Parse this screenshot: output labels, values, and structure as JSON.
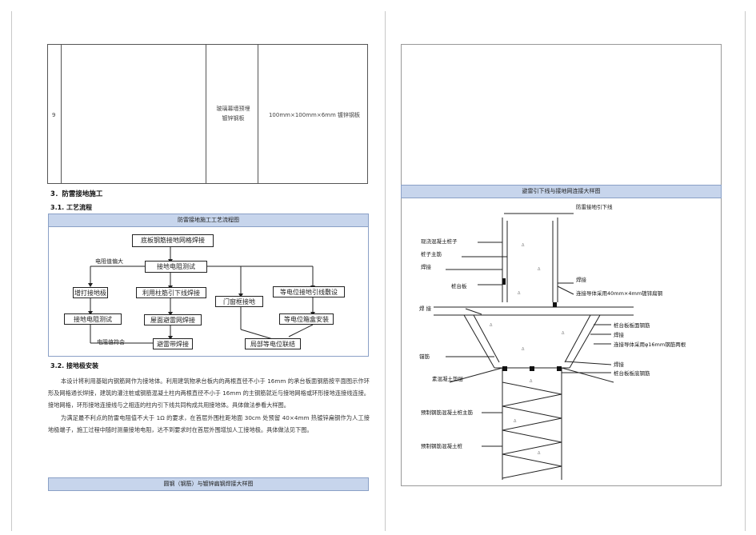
{
  "table": {
    "row_no": "9",
    "name": [
      "玻璃幕墙预埋",
      "镀锌钢板"
    ],
    "spec": "100mm×100mm×6mm 镀锌钢板"
  },
  "section3": {
    "title": "3．防雷接地施工",
    "sub1": "3.1. 工艺流程",
    "flow_bar": "防雷接地施工工艺流程图",
    "flow": {
      "top": "底板钢筋接地网格焊接",
      "resist": "接地电阻测试",
      "cond_left": "电阻值偏大",
      "left1": "增打接地极",
      "left2": "接地电阻测试",
      "cond_bottom": "电阻值符合",
      "col2_1": "利用柱筋引下线焊接",
      "col2_2": "屋面避雷网焊接",
      "col2_3": "避雷带焊接",
      "col3_1": "门窗框接地",
      "col4_1": "等电位接地引线敷设",
      "col4_2": "等电位箱盒安装",
      "col4_3": "局部等电位联结"
    },
    "sub2": "3.2. 接地极安装",
    "para1": "本设计将利用基础内钢筋网作为接地体。利用建筑物承台板内的两根直径不小于 16mm 的承台板面钢筋按平面图示作环形及网格通长焊接，建筑的灌注桩或钢筋混凝土柱内两根直径不小于 16mm 的主钢筋就近与接地网格或环形接地连接线连接。接地网格，环形接地连接线与之相连的柱内引下线共同构成共用接地体。具体做法参看大样图。",
    "para2": "为满足最不利点的防雷电阻值不大于 1Ω 的要求，在首层外围柱距地面 30cm 处预留 40×4mm 热镀锌扁钢作为人工接地极端子，施工过程中随时测量接地电阻，达不到要求时在首层外围增加人工接地极。具体做法见下图。",
    "bottom_bar": "圆钢（钢筋）与镀锌扁钢焊接大样图"
  },
  "right_page": {
    "bar": "避雷引下线与接地网连接大样图",
    "labels": {
      "down_lead": "防雷接地引下线",
      "cast_pile": "现浇混凝土桩子",
      "main_bar": "桩子主筋",
      "weld1": "焊接",
      "cap": "桩台板",
      "weld_note": "焊接",
      "flat_steel": "连接导体采用40mm×4mm镀锌扁钢",
      "weld2": "焊 接",
      "cap_top_bar": "桩台板板面钢筋",
      "weld3": "焊接",
      "round_bar": "连接导体采用φ16mm钢筋两根",
      "anchor": "锚筋",
      "plain_concrete": "素混凝土垫层",
      "weld4": "焊接",
      "cap_bottom_bar": "桩台板板底钢筋",
      "precast_main": "预制钢筋混凝土桩主筋",
      "precast_pile": "预制钢筋混凝土桩"
    }
  }
}
